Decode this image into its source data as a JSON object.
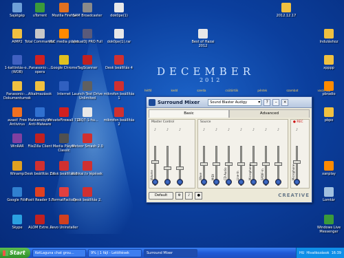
{
  "desktop_icons": [
    {
      "label": "Sajátgép",
      "color": "#6ea0d8"
    },
    {
      "label": "uTorrent",
      "color": "#3b9a3b"
    },
    {
      "label": "Mozilla Firefox",
      "color": "#e07020"
    },
    {
      "label": "SAM Broadcaster",
      "color": "#8a8a8a"
    },
    {
      "label": "dok0pe(1)",
      "color": "#e8e8e8"
    },
    {
      "label": "AIMP2",
      "color": "#f0c040"
    },
    {
      "label": "Total Commander",
      "color": "#c8c8c8"
    },
    {
      "label": "VLC media player",
      "color": "#ff8a00"
    },
    {
      "label": "VirtualDJ PRO Full",
      "color": "#5a5a7a"
    },
    {
      "label": "dok0pe(1).rar",
      "color": "#e8e8e8"
    },
    {
      "label": "1-kattintás-o... (WOB)",
      "color": "#4060c0"
    },
    {
      "label": "Panasonic-... opera",
      "color": "#d02020"
    },
    {
      "label": "Google Chrome",
      "color": "#e0c020"
    },
    {
      "label": "TagScanner",
      "color": "#c02020"
    },
    {
      "label": "Desk beállítás 4",
      "color": "#d03030"
    },
    {
      "label": "Panasonic-... Dokumentumok",
      "color": "#f0c040"
    },
    {
      "label": "Alkalmazások",
      "color": "#f0c040"
    },
    {
      "label": "Internet",
      "color": "#3060c0"
    },
    {
      "label": "Launch Test Drive Unlimited",
      "color": "#606060"
    },
    {
      "label": "mikrofon beállítás 1",
      "color": "#d03030"
    },
    {
      "label": "avast! Free Antivirus",
      "color": "#f07020"
    },
    {
      "label": "Malwarebytes Anti-Malware",
      "color": "#3070d0"
    },
    {
      "label": "PrivateFirewall 7.0",
      "color": "#d02020"
    },
    {
      "label": "13Q7-1-hu...",
      "color": "#e8e8e8"
    },
    {
      "label": "mikrofon beállítás 2",
      "color": "#d03030"
    },
    {
      "label": "WinRAR",
      "color": "#8040a0"
    },
    {
      "label": "FileZilla Client",
      "color": "#c02020"
    },
    {
      "label": "Media Player Classic",
      "color": "#505050"
    },
    {
      "label": "Meteor Smash 2.0",
      "color": "#d03030"
    },
    {
      "label": "FL Studio 10",
      "color": "#f08020"
    },
    {
      "label": "Winamp",
      "color": "#e0a020"
    },
    {
      "label": "Desk beállítás 2.1",
      "color": "#d03030"
    },
    {
      "label": "Desk beállítás 1",
      "color": "#d03030"
    },
    {
      "label": "Google Föld",
      "color": "#3080d0"
    },
    {
      "label": "Foxit Reader 5.0",
      "color": "#e04020"
    },
    {
      "label": "FormatFactory",
      "color": "#e04040"
    },
    {
      "label": "Kenkai.tv lépések",
      "color": "#d03030"
    },
    {
      "label": "Skype",
      "color": "#2aa0e0"
    },
    {
      "label": "ALOM Extre...",
      "color": "#c02020"
    },
    {
      "label": "Revo Uninstaller",
      "color": "#d04020"
    },
    {
      "label": "Desk beállítás 2.",
      "color": "#d03030"
    },
    {
      "label": "2012.12.17",
      "color": "#f0c040"
    },
    {
      "label": "Best of Hazai 2012",
      "color": "#e8e8e8"
    },
    {
      "label": "Induláshoz",
      "color": "#f0c040"
    },
    {
      "label": "xpppp",
      "color": "#f0c040"
    },
    {
      "label": "pbradio",
      "color": "#ff8a00"
    },
    {
      "label": "pbpo",
      "color": "#f0c040"
    },
    {
      "label": "xanplay",
      "color": "#ff8a00"
    },
    {
      "label": "Lomtár",
      "color": "#a0c0e0"
    },
    {
      "label": "Windows Live Messenger",
      "color": "#3a9a3a"
    }
  ],
  "calendar": {
    "month": "DECEMBER",
    "year": "2012",
    "days": [
      "hétfő",
      "kedd",
      "szerda",
      "csütörtök",
      "péntek",
      "szombat",
      "vasárnap"
    ]
  },
  "mixer": {
    "title": "Surround Mixer",
    "device": "Sound Blaster Audigy",
    "help": "?",
    "tabs": [
      {
        "label": "Basic",
        "active": true
      },
      {
        "label": "Advanced",
        "active": false
      }
    ],
    "master": {
      "label": "Master Control",
      "channels": [
        {
          "label": "Volume",
          "level": 0.6
        },
        {
          "label": "",
          "level": 0.45
        },
        {
          "label": "",
          "level": 0.45
        }
      ]
    },
    "source": {
      "label": "Source",
      "channels": [
        {
          "label": "Wave",
          "level": 0.55
        },
        {
          "label": "MIDI",
          "level": 0.55
        },
        {
          "label": "CD Audio",
          "level": 0.55
        },
        {
          "label": "Line-In",
          "level": 0.55
        },
        {
          "label": "Microphone",
          "level": 0.55
        },
        {
          "label": "SPDIF-In",
          "level": 0.55
        },
        {
          "label": "",
          "level": 0.55
        }
      ]
    },
    "record": {
      "label": "● REC",
      "channels": [
        {
          "label": "Microphone",
          "level": 0.6
        }
      ]
    },
    "default_button": "Default",
    "brand": "CREATIVE"
  },
  "taskbar": {
    "start": "Start",
    "buttons": [
      {
        "label": "KetLaguna chat grou...",
        "active": false
      },
      {
        "label": "9% | 1 fájl - Letöltések",
        "active": false
      },
      {
        "label": "Surround Mixer",
        "active": true
      }
    ],
    "tray": [
      "HU",
      "Hivatkozások"
    ],
    "clock": "16:39"
  }
}
